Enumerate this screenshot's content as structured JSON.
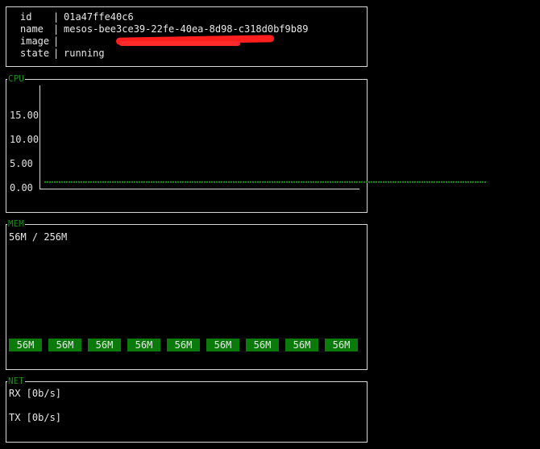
{
  "info": {
    "rows": [
      {
        "key": "id",
        "sep": "|",
        "value": "01a47ffe40c6"
      },
      {
        "key": "name",
        "sep": "|",
        "value": "mesos-bee3ce39-22fe-40ea-8d98-c318d0bf9b89"
      },
      {
        "key": "image",
        "sep": "|",
        "value": ""
      },
      {
        "key": "state",
        "sep": "|",
        "value": "running"
      }
    ],
    "redaction_color": "#ff1e1e"
  },
  "cpu": {
    "title": "CPU",
    "y_ticks": [
      "15.00",
      "10.00",
      "5.00",
      "0.00"
    ]
  },
  "chart_data": {
    "type": "scatter",
    "title": "CPU",
    "xlabel": "",
    "ylabel": "",
    "ylim": [
      0,
      15
    ],
    "y_ticks": [
      0,
      5,
      10,
      15
    ],
    "series": [
      {
        "values": [
          1.2,
          1.2,
          1.2,
          1.2,
          1.2,
          1.2,
          1.2,
          1.2,
          1.2,
          1.2,
          1.2,
          1.2,
          1.2,
          1.2,
          1.2,
          1.2,
          1.2,
          1.2,
          1.2,
          1.2,
          1.2,
          1.2,
          1.2,
          1.2,
          1.2,
          1.2,
          1.2,
          1.2,
          1.2,
          1.2,
          1.2,
          1.2,
          1.2,
          1.2,
          1.2,
          1.2,
          1.2,
          1.2,
          1.2,
          1.2,
          1.2,
          1.2,
          1.2,
          1.2,
          1.2,
          1.2,
          1.2,
          1.2,
          1.2,
          1.2,
          1.2,
          1.2,
          1.2,
          1.2,
          1.2,
          1.2,
          1.2,
          1.2,
          1.2,
          1.2,
          1.2,
          1.2,
          1.2,
          1.2,
          1.2,
          1.2,
          1.2,
          1.2,
          1.2,
          1.2,
          1.2,
          1.2,
          1.2,
          1.2,
          1.2,
          1.2,
          1.2,
          1.2,
          1.2,
          1.2,
          1.2,
          1.2,
          1.2,
          1.2,
          1.2,
          1.2,
          1.2,
          1.2,
          1.2,
          1.2,
          1.2,
          1.2,
          1.2,
          1.2,
          1.2,
          1.2,
          1.2,
          1.2,
          1.2,
          1.2,
          1.2,
          1.2,
          1.2,
          1.2,
          1.2,
          1.2,
          1.2,
          1.2,
          1.2,
          1.2,
          1.2,
          1.2,
          1.2,
          1.2,
          1.2,
          1.2,
          1.2,
          1.2,
          1.2,
          1.2,
          1.2,
          1.2,
          1.2,
          1.2,
          1.2,
          1.2,
          1.2,
          1.2,
          1.2,
          1.2,
          1.2,
          1.2,
          1.2,
          1.2,
          1.2,
          1.2,
          1.2,
          1.2,
          1.2,
          1.2,
          1.2,
          1.2,
          1.2,
          1.2,
          1.2,
          1.2,
          1.2,
          1.2,
          1.2,
          1.2,
          1.2,
          1.2,
          1.2,
          1.2,
          1.2,
          1.2,
          1.2,
          1.2,
          1.2,
          1.2,
          1.2,
          1.2,
          1.2,
          1.2,
          1.2,
          1.2,
          1.2,
          1.2,
          1.2,
          1.2,
          1.2,
          1.2,
          1.2,
          1.2,
          1.2,
          1.2,
          1.2,
          1.2,
          1.2,
          1.2,
          1.2,
          1.2,
          1.2
        ]
      }
    ],
    "color": "#1a8f1a"
  },
  "mem": {
    "title": "MEM",
    "usage": "56M / 256M",
    "bars": [
      "56M",
      "56M",
      "56M",
      "56M",
      "56M",
      "56M",
      "56M",
      "56M",
      "56M"
    ],
    "bar_color": "#0a7a0a"
  },
  "net": {
    "title": "NET",
    "rx": "RX [0b/s]",
    "tx": "TX [0b/s]"
  },
  "colors": {
    "accent": "#1a8f1a",
    "border": "#d8d8d8",
    "background": "#000000"
  }
}
